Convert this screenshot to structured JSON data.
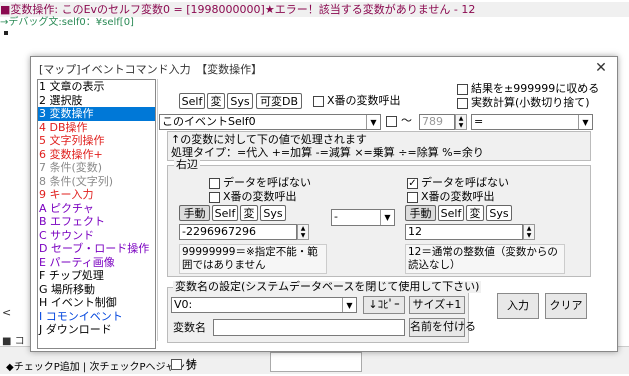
{
  "background": {
    "error_line": "■変数操作: このEvのセルフ変数0 = [1998000000]★エラー！該当する変数がありません - 12",
    "debug_line": "→デバッグ文:self0：¥self[0]",
    "left_tab_label": "<",
    "left_tab2_label": "■ コ",
    "bottom_text": "◆チェックP追加 | 次チェックPへジャンプ",
    "bottom_toku": "特"
  },
  "dialog": {
    "title": "[マップ]イベントコマンド入力　【変数操作】",
    "close": "✕",
    "commands": [
      {
        "label": "1 文章の表示",
        "color": "#000000"
      },
      {
        "label": "2 選択肢",
        "color": "#000000"
      },
      {
        "label": "3 変数操作",
        "color": "#ffffff",
        "selected": true
      },
      {
        "label": "4 DB操作",
        "color": "#e0201e"
      },
      {
        "label": "5 文字列操作",
        "color": "#e0201e"
      },
      {
        "label": "6 変数操作+",
        "color": "#e0201e"
      },
      {
        "label": "7 条件(変数)",
        "color": "#8a8a8a"
      },
      {
        "label": "8 条件(文字列)",
        "color": "#8a8a8a"
      },
      {
        "label": "9 キー入力",
        "color": "#e0201e"
      },
      {
        "label": "A ピクチャ",
        "color": "#7a00c0"
      },
      {
        "label": "B エフェクト",
        "color": "#7a00c0"
      },
      {
        "label": "C サウンド",
        "color": "#7a00c0"
      },
      {
        "label": "D セーブ・ロード操作",
        "color": "#7a00c0"
      },
      {
        "label": "E パーティ画像",
        "color": "#7a00c0"
      },
      {
        "label": "F チップ処理",
        "color": "#000000"
      },
      {
        "label": "G 場所移動",
        "color": "#000000"
      },
      {
        "label": "H イベント制御",
        "color": "#000000"
      },
      {
        "label": "I コモンイベント",
        "color": "#0044dd"
      },
      {
        "label": "J ダウンロード",
        "color": "#000000"
      }
    ],
    "toggles": {
      "self": "Self",
      "hen": "変",
      "sys": "Sys",
      "kahen_db": "可変DB"
    },
    "x_var_call": "X番の変数呼出",
    "result_clamp": "結果を±999999に収める",
    "real_calc": "実数計算(小数切り捨て)",
    "target_dropdown": "このイベントSelf0",
    "range_sign": "～",
    "range_value": "789",
    "assign_op": "=",
    "info_text_1": "↑の変数に対して下の値で処理されます",
    "info_text_2": "処理タイプ：=代入 +=加算 -=減算 ×=乗算 ÷=除算 %=余り",
    "right_side": {
      "group_label": "右辺",
      "left": {
        "no_data_call": "データを呼ばない",
        "x_var_call": "X番の変数呼出",
        "manual": "手動",
        "self": "Self",
        "hen": "変",
        "sys": "Sys",
        "value": "-2296967296",
        "note": "99999999＝※指定不能・範囲ではありません"
      },
      "operator": "-",
      "right": {
        "no_data_call": "データを呼ばない",
        "x_var_call": "X番の変数呼出",
        "manual": "手動",
        "self": "Self",
        "hen": "変",
        "sys": "Sys",
        "value": "12",
        "note": "12＝通常の整数値（変数からの読込なし）"
      }
    },
    "var_name": {
      "group_label": "変数名の設定(システムデータベースを閉じて使用して下さい)",
      "dropdown_value": "V0:",
      "copy": "↓ｺﾋﾟｰ",
      "size": "サイズ+1",
      "name_label": "変数名",
      "name_value": "",
      "apply": "名前を付ける"
    },
    "input_button": "入力",
    "clear_button": "クリア"
  }
}
